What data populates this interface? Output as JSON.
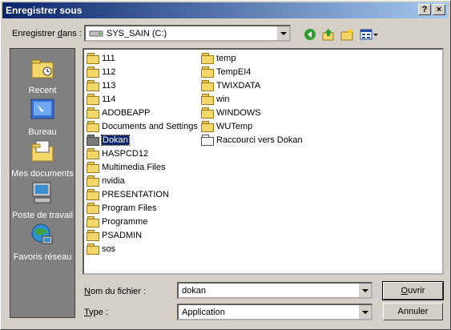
{
  "title": "Enregistrer sous",
  "title_buttons": {
    "help": "?",
    "close": "×"
  },
  "save_in": {
    "label_pre": "Enregistrer ",
    "label_accel": "d",
    "label_post": "ans :",
    "value": "SYS_SAIN (C:)"
  },
  "toolbar": {
    "back_icon": "back-arrow-icon",
    "up_icon": "up-folder-icon",
    "new_folder_icon": "new-folder-icon",
    "views_icon": "views-menu-icon"
  },
  "places": [
    {
      "label": "Recent",
      "icon": "recent-folder-icon"
    },
    {
      "label": "Bureau",
      "icon": "desktop-icon"
    },
    {
      "label": "Mes documents",
      "icon": "my-documents-icon"
    },
    {
      "label": "Poste de travail",
      "icon": "my-computer-icon"
    },
    {
      "label": "Favoris réseau",
      "icon": "network-places-icon"
    }
  ],
  "files_col1": [
    "111",
    "112",
    "113",
    "114",
    "ADOBEAPP",
    "Documents and Settings",
    "Dokan",
    "HASPCD12",
    "Multimedia Files",
    "nvidia",
    "PRESENTATION",
    "Program Files",
    "Programme",
    "PSADMIN",
    "sos"
  ],
  "files_col2": [
    "temp",
    "TempEI4",
    "TWIXDATA",
    "win",
    "WINDOWS",
    "WUTemp",
    "Raccourci vers Dokan"
  ],
  "selected": "Dokan",
  "filename": {
    "label_accel": "N",
    "label_post": "om du fichier :",
    "value": "dokan"
  },
  "filetype": {
    "label_accel": "T",
    "label_post": "ype :",
    "value": "Application"
  },
  "buttons": {
    "open_accel": "O",
    "open_post": "uvrir",
    "cancel": "Annuler"
  },
  "colors": {
    "title_start": "#0a246a",
    "title_end": "#a6caf0",
    "face": "#d4d0c8",
    "places_bg": "#808080"
  }
}
